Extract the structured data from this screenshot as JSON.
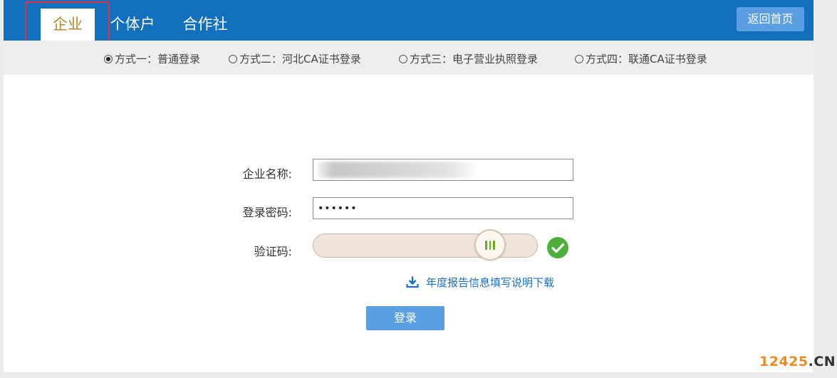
{
  "tabs": [
    {
      "label": "企业",
      "active": true
    },
    {
      "label": "个体户",
      "active": false
    },
    {
      "label": "合作社",
      "active": false
    }
  ],
  "header": {
    "home_button": "返回首页"
  },
  "login_methods": [
    {
      "label": "方式一：普通登录",
      "selected": true
    },
    {
      "label": "方式二：河北CA证书登录",
      "selected": false
    },
    {
      "label": "方式三：电子营业执照登录",
      "selected": false
    },
    {
      "label": "方式四：联通CA证书登录",
      "selected": false
    }
  ],
  "form": {
    "name_label": "企业名称:",
    "password_label": "登录密码:",
    "password_value": "••••••",
    "captcha_label": "验证码:",
    "captcha_verified": true
  },
  "download_link": "年度报告信息填写说明下载",
  "login_button": "登录",
  "watermark": {
    "number": "12425",
    "suffix": ".CN"
  },
  "colors": {
    "header_bg": "#1270bf",
    "active_tab_text": "#b8862a",
    "button_bg": "#5a9ee3",
    "highlight_border": "#e0313b",
    "success": "#4caf3b"
  }
}
